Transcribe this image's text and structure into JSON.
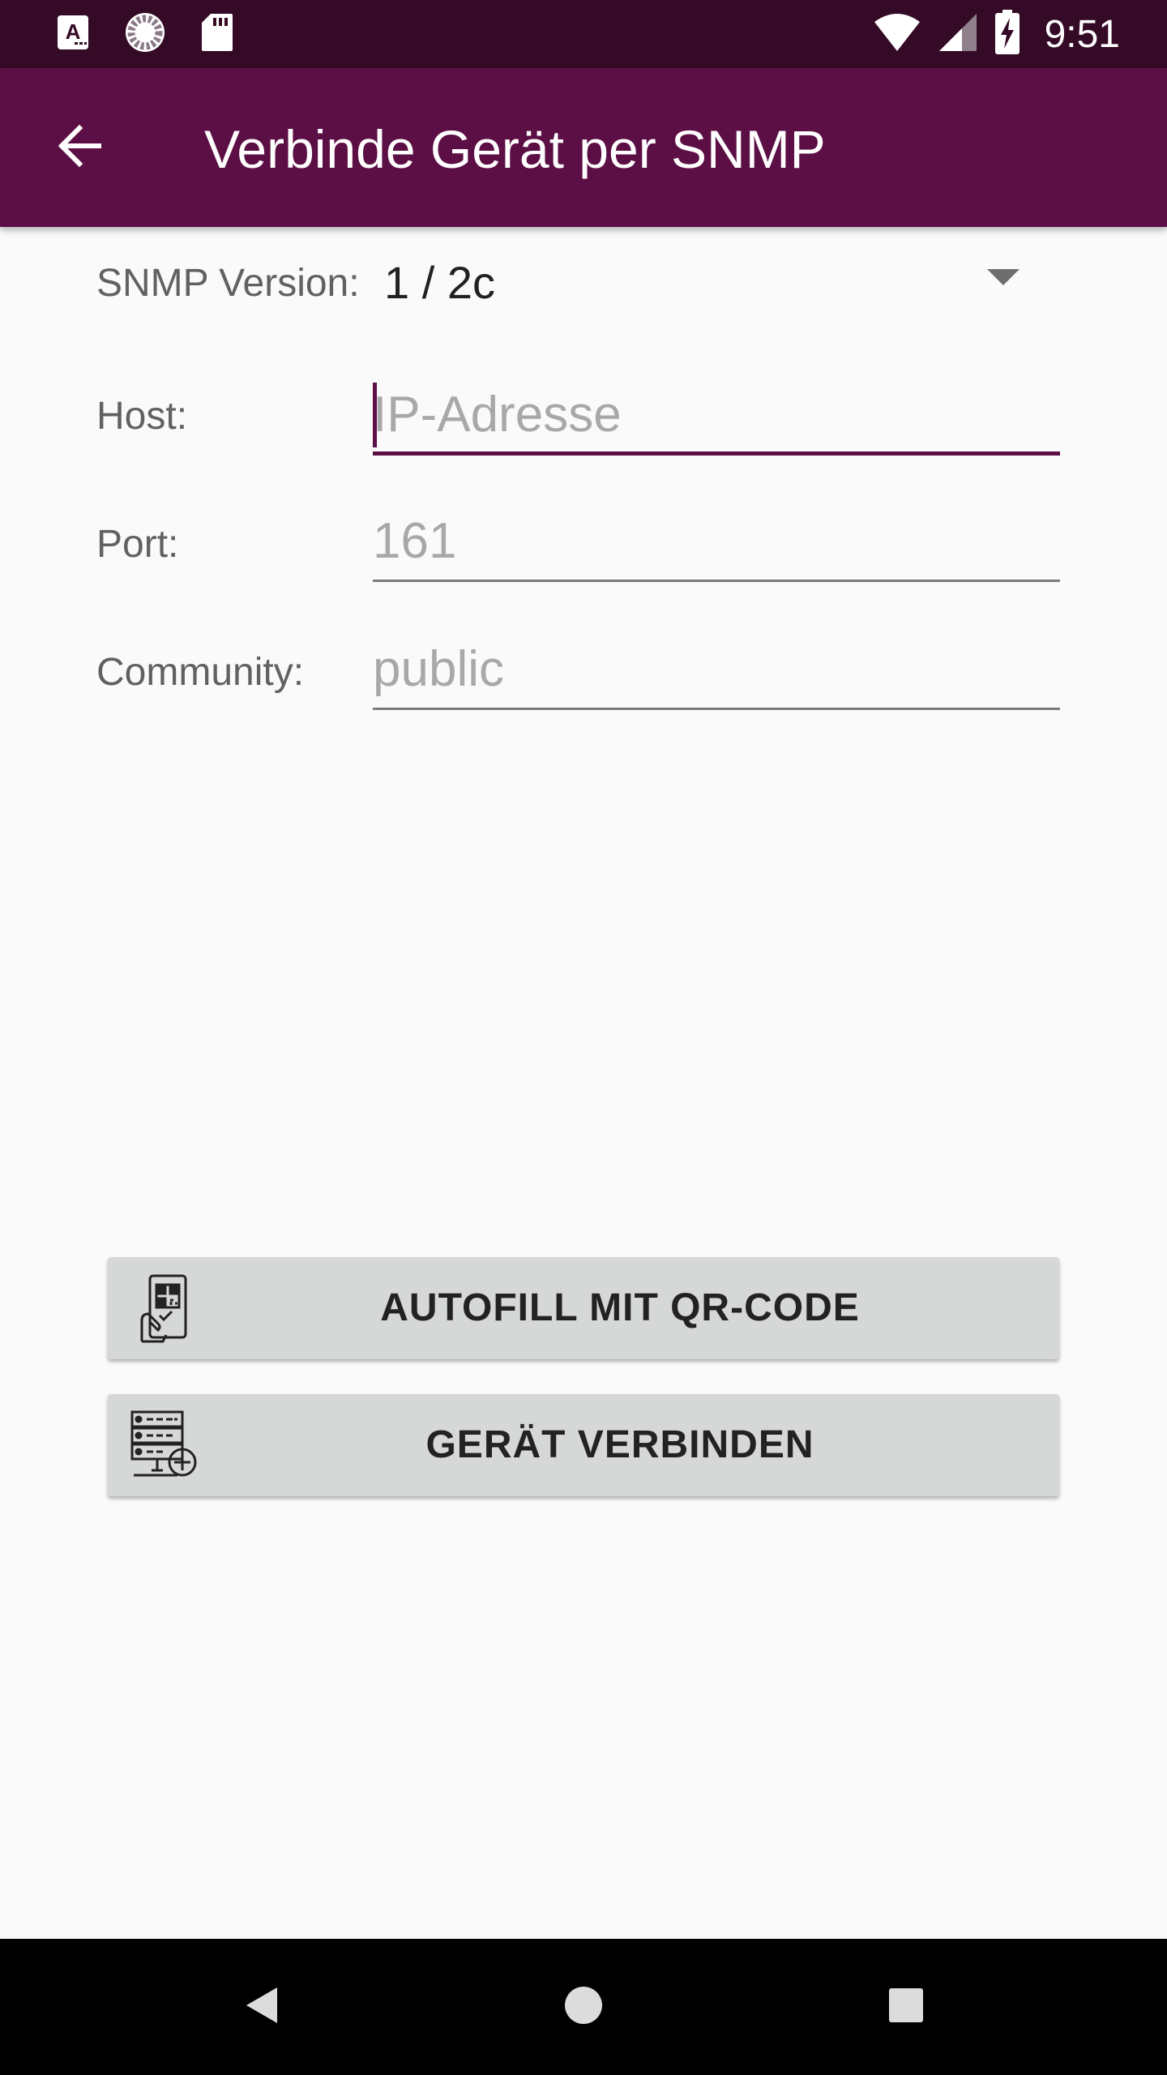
{
  "status_bar": {
    "time": "9:51",
    "left_icons": [
      "font-a-icon",
      "sync-progress-icon",
      "sd-card-icon"
    ],
    "right_icons": [
      "wifi-icon",
      "cell-signal-icon",
      "battery-charging-icon"
    ]
  },
  "app_bar": {
    "title": "Verbinde Gerät per SNMP",
    "back_icon": "arrow-left-icon"
  },
  "form": {
    "version_label": "SNMP Version:",
    "version_value": "1 / 2c",
    "host_label": "Host:",
    "host_placeholder": "IP-Adresse",
    "host_value": "",
    "port_label": "Port:",
    "port_placeholder": "161",
    "port_value": "",
    "community_label": "Community:",
    "community_placeholder": "public",
    "community_value": ""
  },
  "buttons": {
    "autofill_label": "AUTOFILL MIT QR-CODE",
    "autofill_icon": "qr-code-phone-icon",
    "connect_label": "GERÄT VERBINDEN",
    "connect_icon": "server-add-icon"
  },
  "nav_bar": {
    "items": [
      "back-triangle-icon",
      "home-circle-icon",
      "recents-square-icon"
    ]
  },
  "colors": {
    "status_bar": "#350a26",
    "app_bar": "#5c0f45",
    "accent": "#5c0f45",
    "background": "#fafafa",
    "button_bg": "#d6d7d7"
  }
}
